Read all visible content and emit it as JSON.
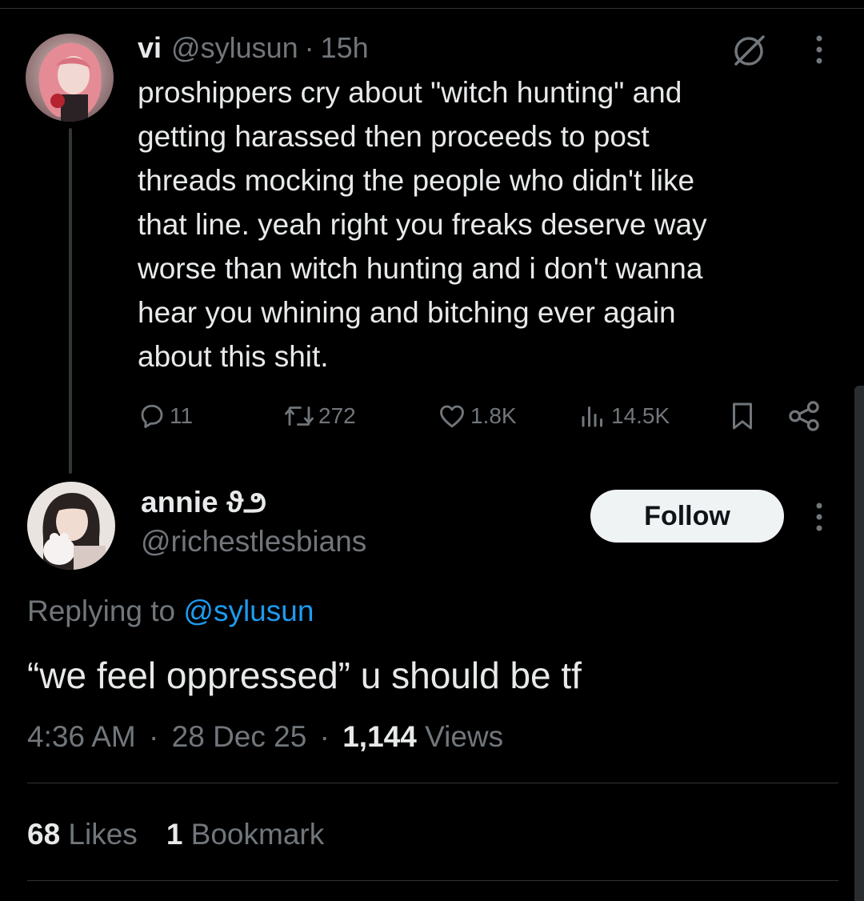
{
  "tweet": {
    "author_name": "vi",
    "author_handle": "@sylusun",
    "separator": "·",
    "time": "15h",
    "body_lines": [
      "proshippers cry about \"witch hunting\" and",
      "getting harassed then proceeds to post",
      "threads mocking the people who didn't like",
      "that line. yeah right you freaks deserve way",
      "worse than witch hunting and i don't wanna",
      "hear you whining and bitching ever again",
      "about this shit."
    ],
    "stats": {
      "replies": "11",
      "reposts": "272",
      "likes": "1.8K",
      "views": "14.5K"
    },
    "icons": [
      "grok-icon",
      "more-icon",
      "reply-icon",
      "repost-icon",
      "like-icon",
      "views-icon",
      "bookmark-icon",
      "share-icon"
    ]
  },
  "reply": {
    "author_name": "annie ϑ౨",
    "author_handle": "@richestlesbians",
    "follow_label": "Follow",
    "replying_prefix": "Replying to ",
    "replying_mention": "@sylusun",
    "text": "“we feel oppressed” u should be tf",
    "time": "4:36 AM",
    "date": "28 Dec 25",
    "separator": "·",
    "views_count": "1,144",
    "views_label": " Views",
    "likes_count": "68",
    "likes_label": " Likes",
    "bookmarks_count": "1",
    "bookmarks_label": " Bookmark"
  },
  "colors": {
    "background": "#000000",
    "text": "#e7e9ea",
    "muted": "#71767b",
    "link": "#1d9bf0",
    "follow_button_bg": "#eff3f4"
  }
}
